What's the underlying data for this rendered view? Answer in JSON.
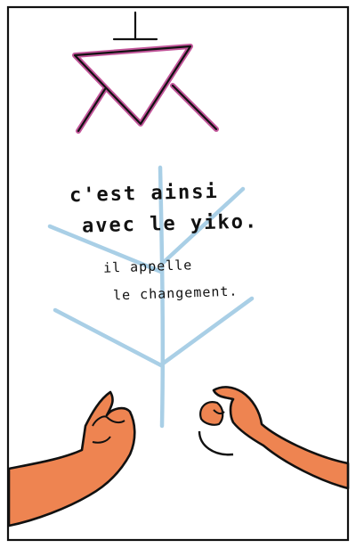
{
  "caption": {
    "line1": "c'est ainsi",
    "line2": "avec le yiko.",
    "line3": "il appelle",
    "line4": "le changement."
  },
  "colors": {
    "ink": "#111111",
    "symbol_magenta": "#c2559a",
    "tree_blue": "#a9cfe6",
    "skin_orange": "#ee8451"
  },
  "icons": {
    "symbol": "inverted-triangle-symbol",
    "tree": "branching-tree-drawing",
    "hands": "open-hands-drawing"
  }
}
